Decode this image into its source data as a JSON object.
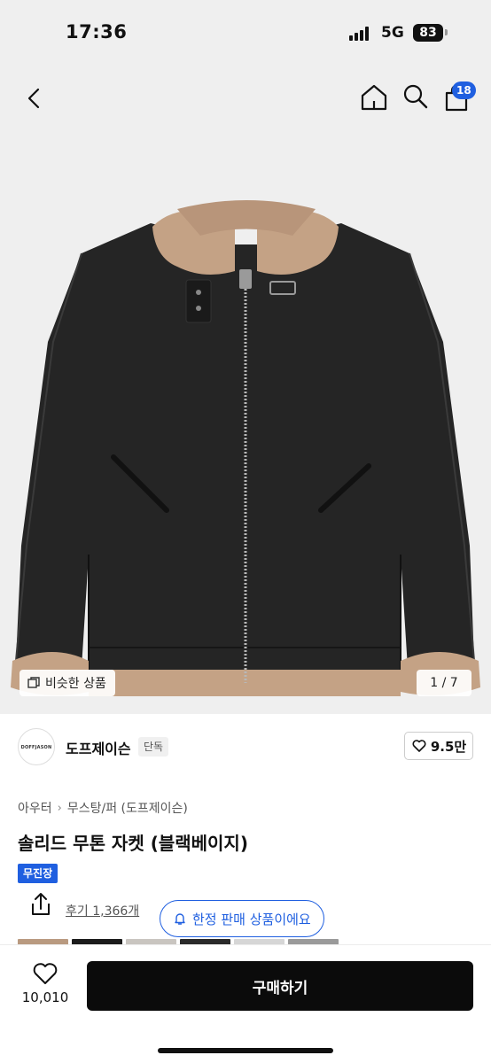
{
  "status_bar": {
    "time": "17:36",
    "network": "5G",
    "battery": "83"
  },
  "nav": {
    "cart_count": "18"
  },
  "gallery": {
    "similar_label": "비슷한 상품",
    "page_counter": "1 / 7"
  },
  "brand": {
    "logo_text": "DOFFJASON",
    "name": "도프제이슨",
    "tag": "단독",
    "likes": "9.5만"
  },
  "breadcrumb": {
    "level1": "아우터",
    "level2": "무스탕/퍼 (도프제이슨)"
  },
  "product": {
    "title": "솔리드 무톤 자켓 (블랙베이지)",
    "badge": "무진장",
    "reviews": "후기 1,366개",
    "limited_label": "한정 판매 상품이에요"
  },
  "bottom_bar": {
    "like_count": "10,010",
    "buy_label": "구매하기"
  },
  "colors": {
    "accent": "#1f5fe0",
    "buy_button": "#0b0b0b",
    "hero_bg": "#efefef"
  },
  "icons": [
    "back-icon",
    "home-icon",
    "search-icon",
    "cart-icon",
    "similar-icon",
    "heart-icon",
    "share-icon",
    "bell-icon"
  ]
}
